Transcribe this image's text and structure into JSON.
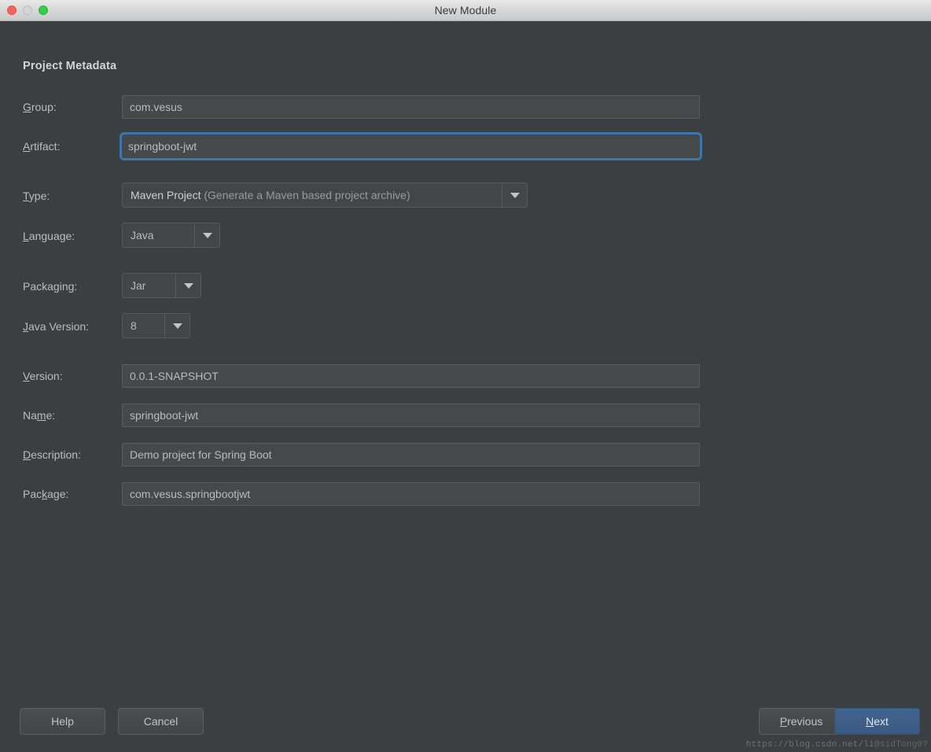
{
  "window": {
    "title": "New Module",
    "controls": {
      "close": "close-button",
      "minimize": "minimize-button",
      "zoom": "zoom-button"
    }
  },
  "section": {
    "title": "Project Metadata"
  },
  "fields": {
    "group": {
      "label_pre": "",
      "label_mnemonic": "G",
      "label_post": "roup:",
      "value": "com.vesus",
      "focused": false
    },
    "artifact": {
      "label_pre": "",
      "label_mnemonic": "A",
      "label_post": "rtifact:",
      "value": "springboot-jwt",
      "focused": true
    },
    "type": {
      "label_pre": "",
      "label_mnemonic": "T",
      "label_post": "ype:",
      "value_strong": "Maven Project",
      "value_dim": "(Generate a Maven based project archive)"
    },
    "language": {
      "label_pre": "",
      "label_mnemonic": "L",
      "label_post": "anguage:",
      "value": "Java"
    },
    "packaging": {
      "label_pre": "Packa",
      "label_mnemonic": "g",
      "label_post": "ing:",
      "value": "Jar"
    },
    "java_version": {
      "label_pre": "",
      "label_mnemonic": "J",
      "label_post": "ava Version:",
      "value": "8"
    },
    "version": {
      "label_pre": "",
      "label_mnemonic": "V",
      "label_post": "ersion:",
      "value": "0.0.1-SNAPSHOT"
    },
    "name": {
      "label_pre": "Na",
      "label_mnemonic": "m",
      "label_post": "e:",
      "value": "springboot-jwt"
    },
    "description": {
      "label_pre": "",
      "label_mnemonic": "D",
      "label_post": "escription:",
      "value": "Demo project for Spring Boot"
    },
    "package": {
      "label_pre": "Pac",
      "label_mnemonic": "k",
      "label_post": "age:",
      "value": "com.vesus.springbootjwt"
    }
  },
  "footer": {
    "help": "Help",
    "cancel": "Cancel",
    "previous_mnemonic": "P",
    "previous_rest": "revious",
    "next_mnemonic": "N",
    "next_rest": "ext"
  },
  "watermark": {
    "text": "https://blog.csdn.net/li",
    "overlap": "@sidTong0?"
  },
  "colors": {
    "dialog_background": "#3c3f41",
    "field_background": "#45494a",
    "field_border": "#5a5d5e",
    "focus_border": "#3e76ab",
    "default_button": "#3a5a80",
    "text": "#bbbbbb",
    "heading": "#d4d4d4",
    "titlebar": "#d6d6d6",
    "close_light": "#fc625d",
    "minimize_light": "#d6d6d6",
    "zoom_light": "#35cd4b"
  }
}
